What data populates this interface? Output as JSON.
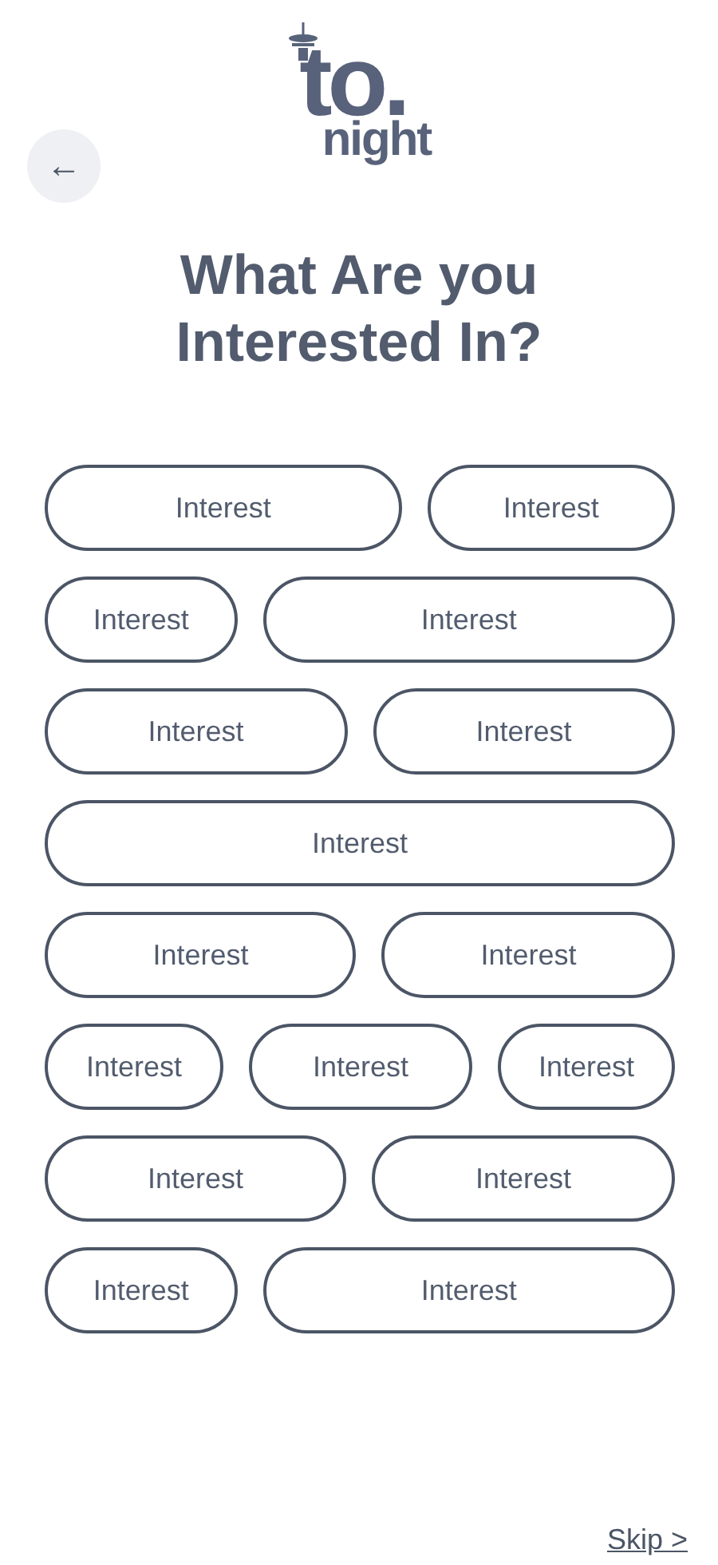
{
  "back_button": {
    "label": "←"
  },
  "logo": {
    "top": "to.",
    "bottom": "night"
  },
  "title": "What Are you Interested In?",
  "interest_rows": [
    [
      {
        "label": "Interest",
        "selected": false
      },
      {
        "label": "Interest",
        "selected": false
      }
    ],
    [
      {
        "label": "Interest",
        "selected": false
      },
      {
        "label": "Interest",
        "selected": false
      }
    ],
    [
      {
        "label": "Interest",
        "selected": false
      },
      {
        "label": "Interest",
        "selected": false
      }
    ],
    [
      {
        "label": "Interest",
        "selected": false
      }
    ],
    [
      {
        "label": "Interest",
        "selected": false
      },
      {
        "label": "Interest",
        "selected": false
      }
    ],
    [
      {
        "label": "Interest",
        "selected": false
      },
      {
        "label": "Interest",
        "selected": false
      },
      {
        "label": "Interest",
        "selected": false
      }
    ],
    [
      {
        "label": "Interest",
        "selected": false
      },
      {
        "label": "Interest",
        "selected": false
      }
    ],
    [
      {
        "label": "Interest",
        "selected": false
      },
      {
        "label": "Interest",
        "selected": false
      }
    ]
  ],
  "skip_link": "Skip >"
}
